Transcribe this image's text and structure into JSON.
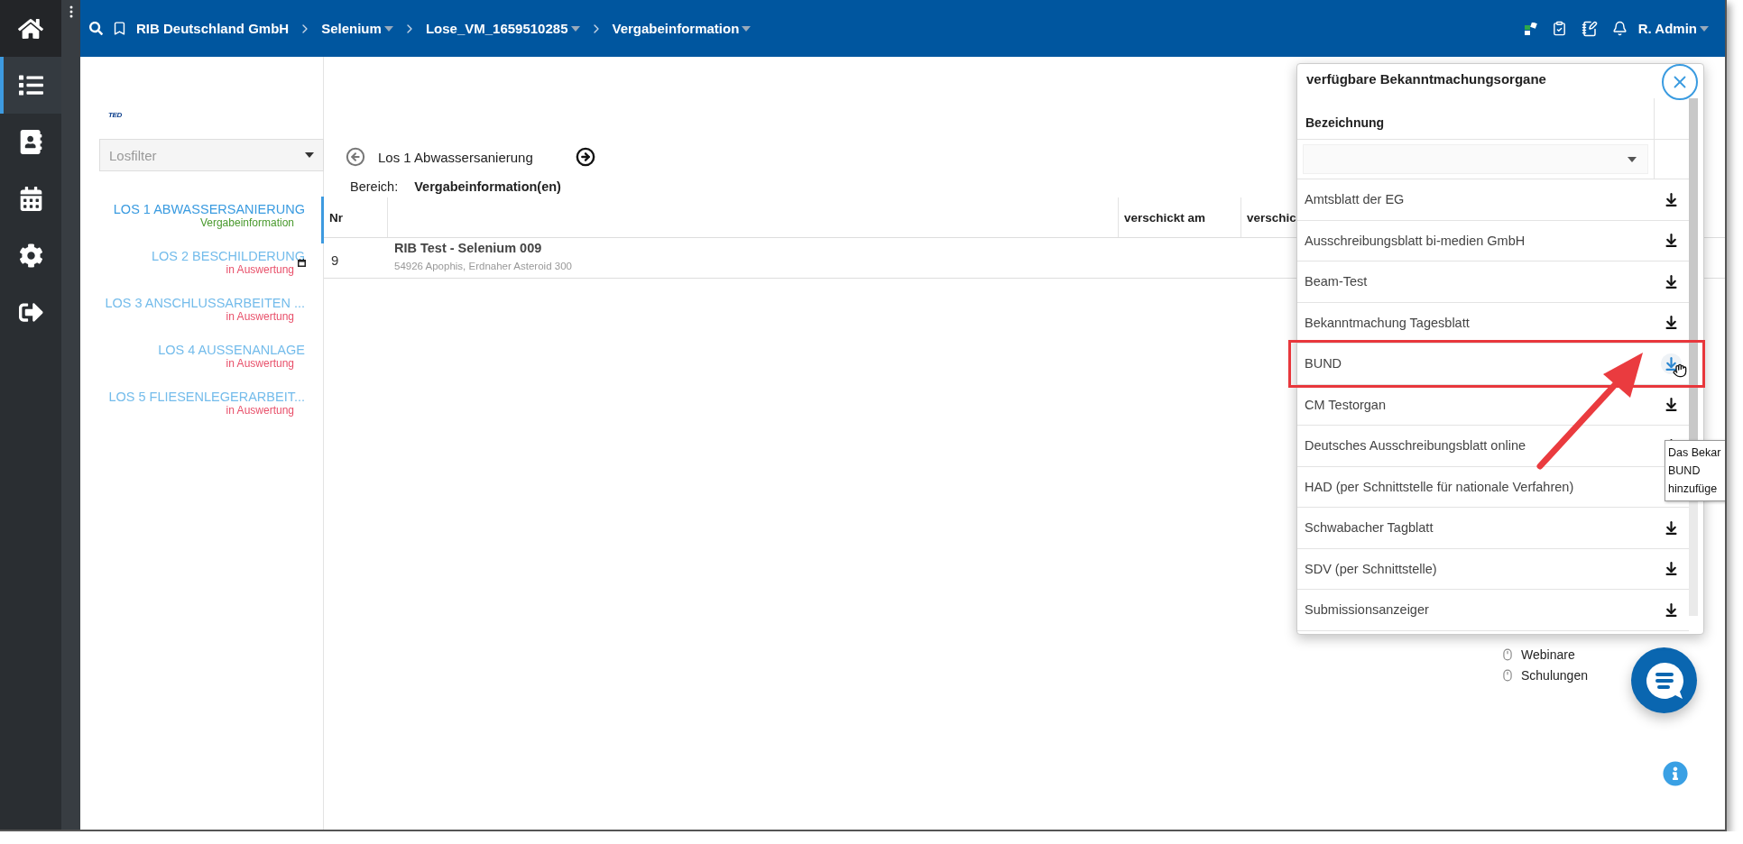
{
  "nav_items": [
    {
      "selected": false
    },
    {
      "selected": true
    },
    {
      "selected": false
    },
    {
      "selected": false
    },
    {
      "selected": false
    },
    {
      "selected": false
    }
  ],
  "breadcrumb": [
    {
      "label": "RIB Deutschland GmbH",
      "dropdown": false
    },
    {
      "label": "Selenium",
      "dropdown": true
    },
    {
      "label": "Lose_VM_1659510285",
      "dropdown": true
    },
    {
      "label": "Vergabeinformation",
      "dropdown": true
    }
  ],
  "user": {
    "name": "R. Admin"
  },
  "logo": "TED",
  "lot_filter": {
    "placeholder": "Losfilter"
  },
  "lots": [
    {
      "title": "LOS 1 ABWASSERSANIERUNG",
      "status": "Vergabeinformation",
      "color": "#4a9a2e",
      "selected": true,
      "calendar_badge": false
    },
    {
      "title": "LOS 2 BESCHILDERUNG",
      "status": "in Auswertung",
      "color": "#e8506a",
      "selected": false,
      "calendar_badge": true
    },
    {
      "title": "LOS 3 ANSCHLUSSARBEITEN ...",
      "status": "in Auswertung",
      "color": "#e8506a",
      "selected": false,
      "calendar_badge": false
    },
    {
      "title": "LOS 4 AUSSENANLAGE",
      "status": "in Auswertung",
      "color": "#e8506a",
      "selected": false,
      "calendar_badge": false
    },
    {
      "title": "LOS 5 FLIESENLEGERARBEIT...",
      "status": "in Auswertung",
      "color": "#e8506a",
      "selected": false,
      "calendar_badge": false
    }
  ],
  "lot_nav": {
    "title": "Los 1 Abwassersanierung"
  },
  "scope": {
    "label": "Bereich:",
    "value": "Vergabeinformation(en)"
  },
  "table": {
    "columns": [
      {
        "kind": "text",
        "label": "Nr"
      },
      {
        "kind": "blank"
      },
      {
        "kind": "text",
        "label": "verschickt am"
      },
      {
        "kind": "text",
        "label": "verschic"
      }
    ],
    "rows": [
      {
        "nr": "9",
        "title": "RIB Test - Selenium 009",
        "subtitle": "54926 Apophis, Erdnaher Asteroid 300"
      }
    ]
  },
  "help_links": [
    {
      "label": "Webinare"
    },
    {
      "label": "Schulungen"
    }
  ],
  "dialog": {
    "title": "verfügbare Bekanntmachungsorgane",
    "column": "Bezeichnung",
    "items": [
      {
        "label": "Amtsblatt der EG",
        "hovered": false,
        "highlighted": false
      },
      {
        "label": "Ausschreibungsblatt bi-medien GmbH",
        "hovered": false,
        "highlighted": false
      },
      {
        "label": "Beam-Test",
        "hovered": false,
        "highlighted": false
      },
      {
        "label": "Bekanntmachung Tagesblatt",
        "hovered": false,
        "highlighted": false
      },
      {
        "label": "BUND",
        "hovered": true,
        "highlighted": true
      },
      {
        "label": "CM Testorgan",
        "hovered": false,
        "highlighted": false
      },
      {
        "label": "Deutsches Ausschreibungsblatt online",
        "hovered": false,
        "highlighted": false
      },
      {
        "label": "HAD (per Schnittstelle für nationale Verfahren)",
        "hovered": false,
        "highlighted": false
      },
      {
        "label": "Schwabacher Tagblatt",
        "hovered": false,
        "highlighted": false
      },
      {
        "label": "SDV (per Schnittstelle)",
        "hovered": false,
        "highlighted": false
      },
      {
        "label": "Submissionsanzeiger",
        "hovered": false,
        "highlighted": false
      }
    ]
  },
  "tooltip": {
    "lines": [
      "Das Bekar",
      "BUND",
      "hinzufüge"
    ]
  }
}
